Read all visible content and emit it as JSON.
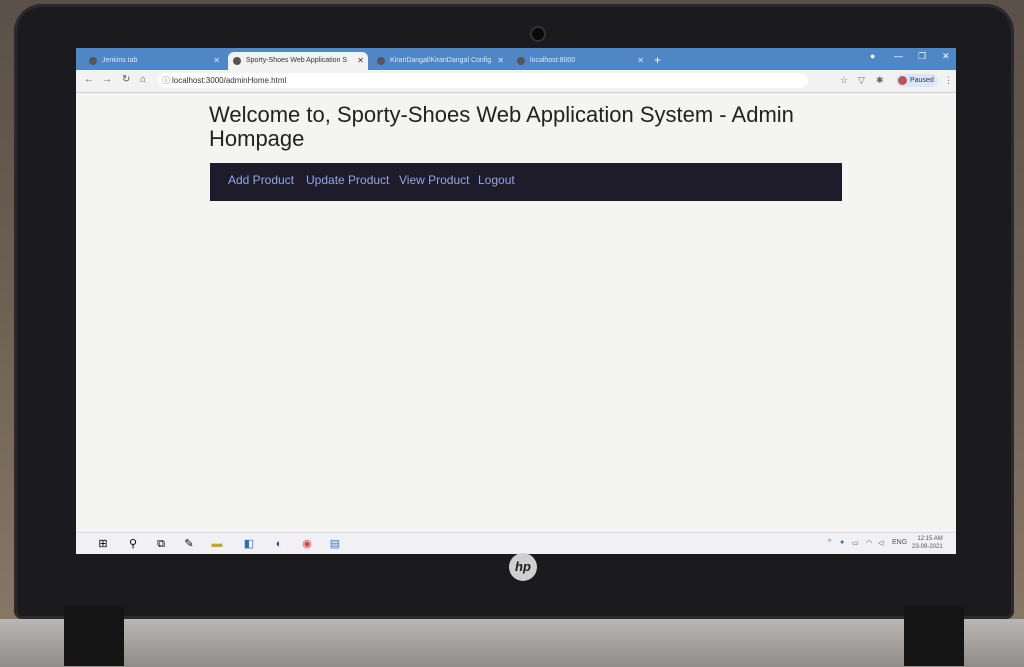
{
  "browser": {
    "tabs": [
      {
        "label": "Jenkins tab",
        "active": false
      },
      {
        "label": "Sporty-Shoes Web Application S",
        "active": true
      },
      {
        "label": "KiranDangal/KiranDangal Config",
        "active": false
      },
      {
        "label": "localhost:8000",
        "active": false
      }
    ],
    "address": "localhost:3000/adminHome.html",
    "profile_status": "Paused"
  },
  "page": {
    "title": "Welcome to, Sporty-Shoes Web Application System - Admin Hompage",
    "nav": [
      "Add Product",
      "Update Product",
      "View Product",
      "Logout"
    ]
  },
  "taskbar": {
    "lang": "ENG",
    "time": "12:15 AM",
    "date": "23-09-2021"
  },
  "colors": {
    "navbar_bg": "#1e1b2a",
    "nav_link": "#8fa8e8",
    "tabstrip": "#4f86c6"
  }
}
